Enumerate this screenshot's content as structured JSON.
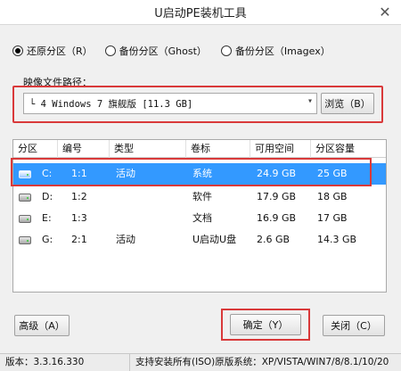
{
  "window": {
    "title": "U启动PE装机工具",
    "close_glyph": "✕"
  },
  "modes": [
    {
      "label": "还原分区（R）",
      "selected": true
    },
    {
      "label": "备份分区（Ghost）",
      "selected": false
    },
    {
      "label": "备份分区（Imagex）",
      "selected": false
    }
  ],
  "image_path": {
    "label": "映像文件路径：",
    "value": "└ 4 Windows 7 旗舰版 [11.3 GB]",
    "dropdown_glyph": "▾",
    "browse_label": "浏览（B）"
  },
  "table": {
    "columns": [
      "分区",
      "编号",
      "类型",
      "卷标",
      "可用空间",
      "分区容量"
    ],
    "rows": [
      {
        "drive": "C:",
        "number": "1:1",
        "type": "活动",
        "label": "系统",
        "free": "24.9 GB",
        "size": "25 GB",
        "selected": true
      },
      {
        "drive": "D:",
        "number": "1:2",
        "type": "",
        "label": "软件",
        "free": "17.9 GB",
        "size": "18 GB",
        "selected": false
      },
      {
        "drive": "E:",
        "number": "1:3",
        "type": "",
        "label": "文档",
        "free": "16.9 GB",
        "size": "17 GB",
        "selected": false
      },
      {
        "drive": "G:",
        "number": "2:1",
        "type": "活动",
        "label": "U启动U盘",
        "free": "2.6 GB",
        "size": "14.3 GB",
        "selected": false
      }
    ]
  },
  "buttons": {
    "advanced": "高级（A）",
    "confirm": "确定（Y）",
    "close": "关闭（C）"
  },
  "status": {
    "version": "版本：3.3.16.330",
    "systems": "支持安装所有(ISO)原版系统：XP/VISTA/WIN7/8/8.1/10/20"
  }
}
